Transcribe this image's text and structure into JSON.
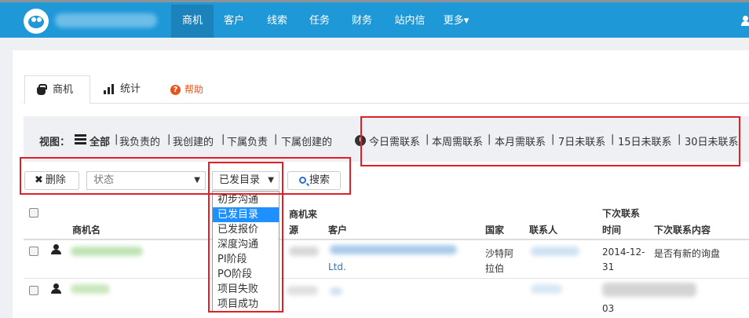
{
  "nav": {
    "items": [
      "商机",
      "客户",
      "线索",
      "任务",
      "财务",
      "站内信",
      "更多"
    ],
    "active": "商机",
    "more_caret": "▾"
  },
  "tabs": {
    "deals": "商机",
    "stats": "统计",
    "help": "帮助",
    "help_badge": "?"
  },
  "viewbar": {
    "label": "视图：",
    "views": [
      "全部",
      "我负责的",
      "我创建的",
      "下属负责",
      "下属创建的"
    ],
    "contact_filters": [
      "今日需联系",
      "本周需联系",
      "本月需联系",
      "7日未联系",
      "15日未联系",
      "30日未联系"
    ],
    "separator": "|"
  },
  "toolbar": {
    "delete_label": "删除",
    "delete_icon": "✖",
    "status_placeholder": "状态",
    "stage_selected": "已发目录",
    "caret": "▼",
    "search_label": "搜索"
  },
  "stage_options": [
    "初步沟通",
    "已发目录",
    "已发报价",
    "深度沟通",
    "PI阶段",
    "PO阶段",
    "项目失败",
    "项目成功"
  ],
  "table": {
    "headers": {
      "name": "商机名",
      "source_1": "商机来",
      "source_2": "源",
      "customer": "客户",
      "country": "国家",
      "contact": "联系人",
      "next_time_1": "下次联系",
      "next_time_2": "时间",
      "next_content": "下次联系内容"
    },
    "rows": [
      {
        "customer_tail": "Ltd.",
        "country_1": "沙特阿",
        "country_2": "拉伯",
        "next_time_1": "2014-12-",
        "next_time_2": "31",
        "next_content": "是否有新的询盘"
      },
      {
        "next_time_2": "03"
      }
    ]
  },
  "colors": {
    "nav_bg": "#1f98d8",
    "nav_active": "#1b82bb",
    "annotation_red": "#e11f26",
    "link_blue": "#2a7ab8",
    "dropdown_selected": "#1e90ff"
  }
}
